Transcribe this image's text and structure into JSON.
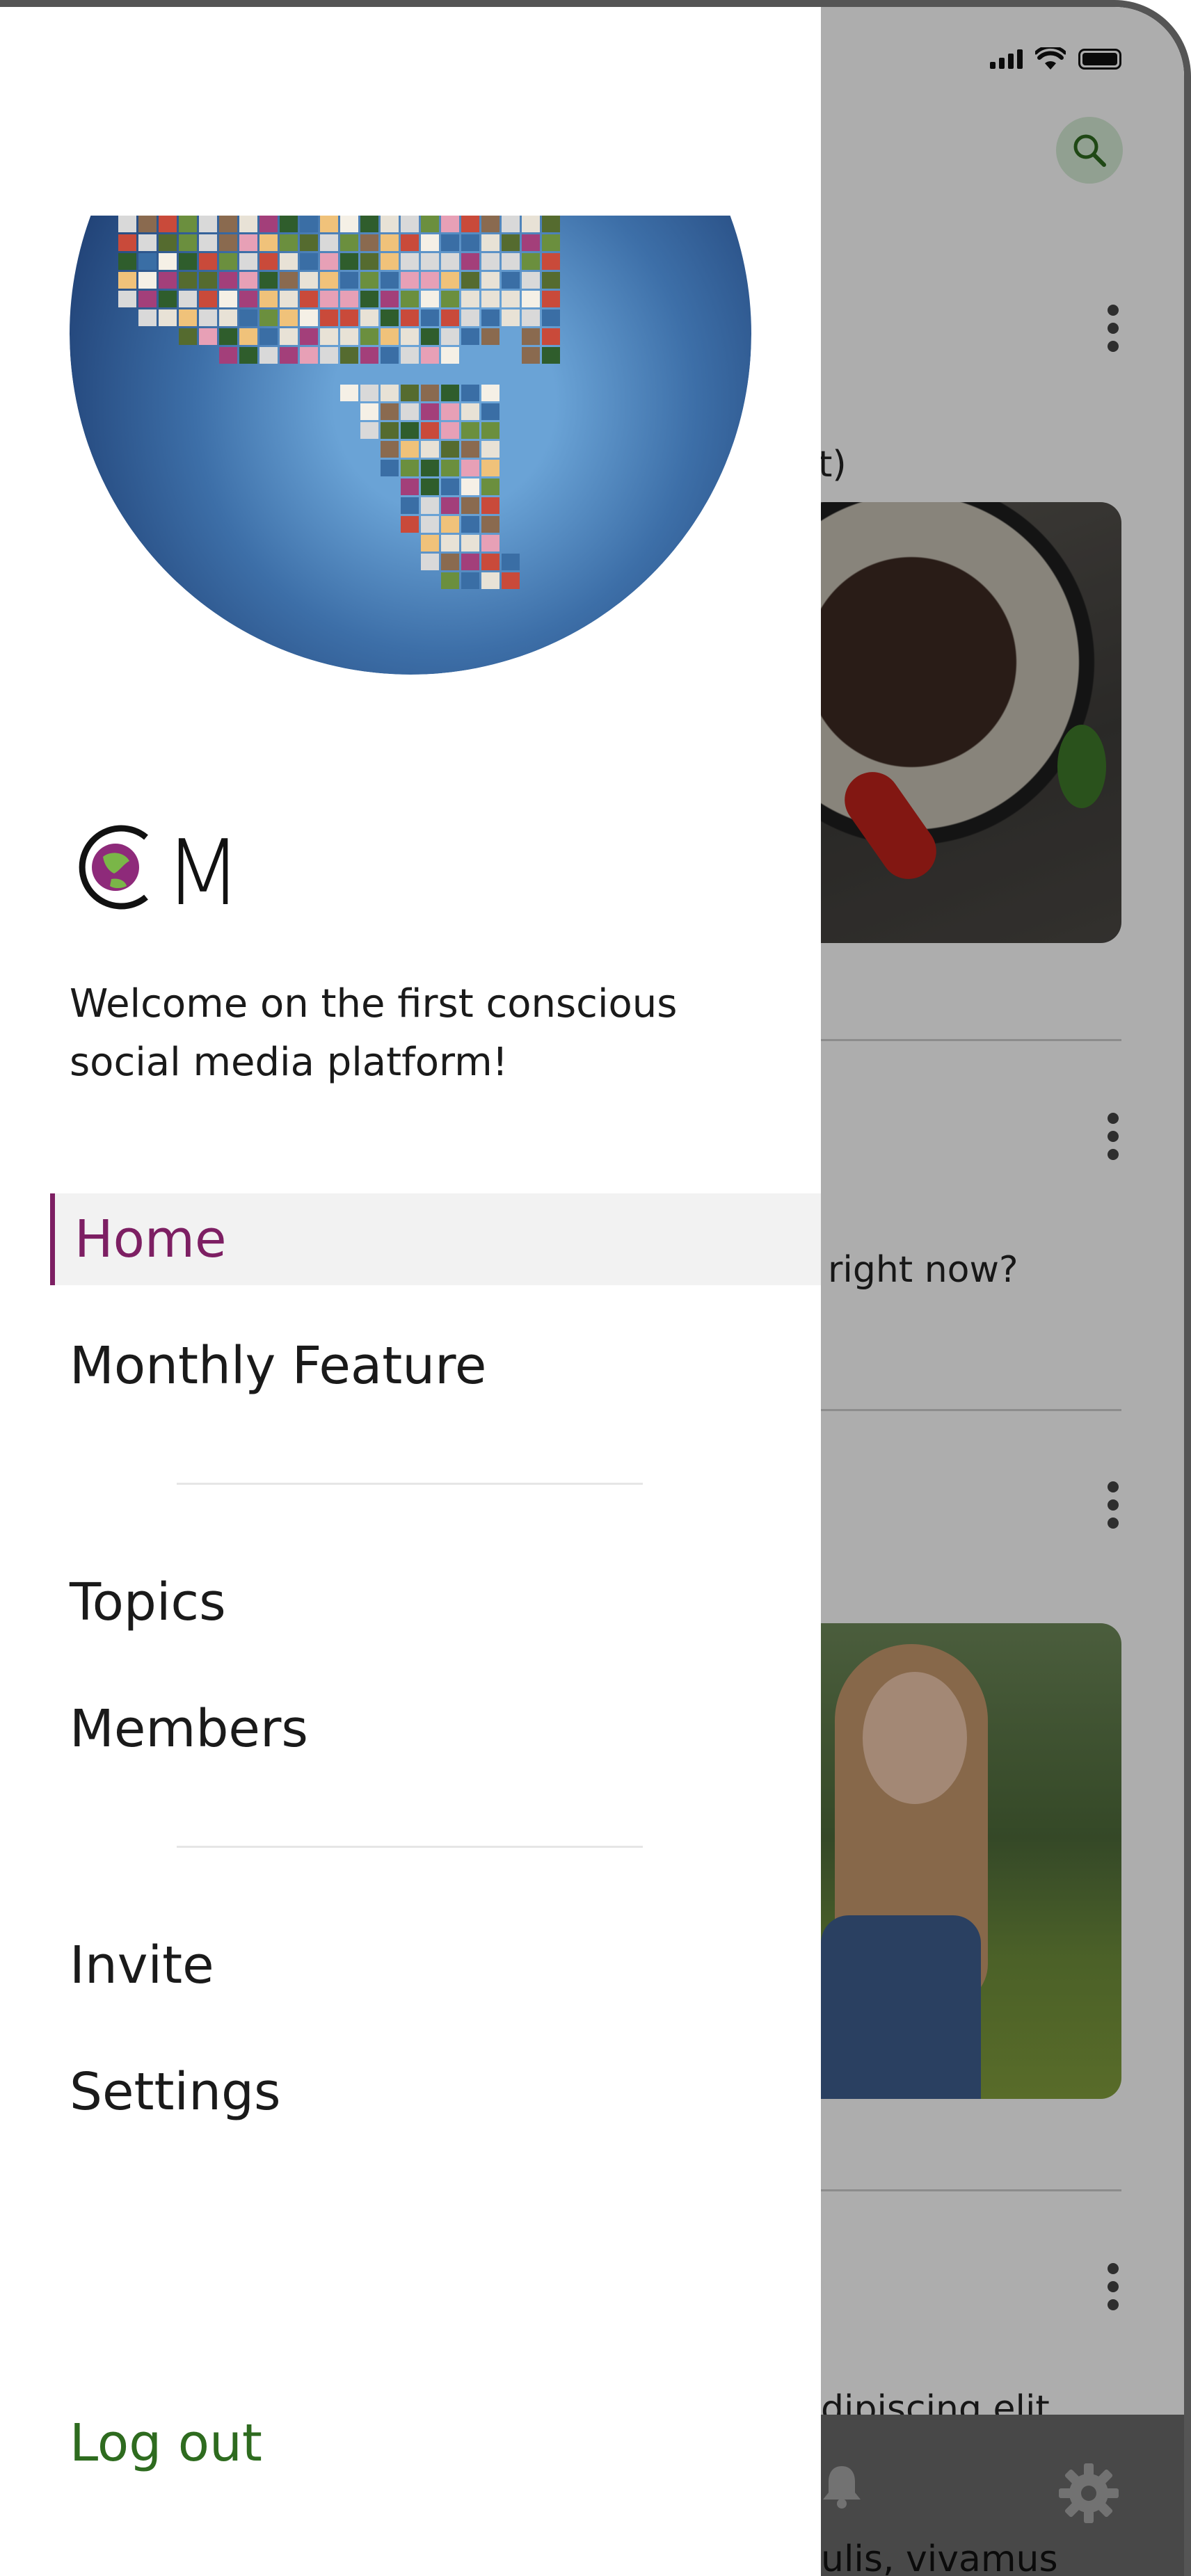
{
  "background_app": {
    "feed": [
      {
        "snippet": "t)"
      },
      {
        "snippet": "right now?"
      },
      {
        "snippet": "dipiscing elit"
      },
      {
        "snippet": "ulis, vivamus"
      }
    ],
    "icons": {
      "search": "search-icon",
      "more": "more-options-icon",
      "notifications": "bell-icon",
      "settings": "gear-icon"
    }
  },
  "drawer": {
    "welcome_text": "Welcome on the first conscious social media platform!",
    "nav_primary": [
      {
        "label": "Home",
        "active": true
      },
      {
        "label": "Monthly Feature",
        "active": false
      }
    ],
    "nav_secondary": [
      {
        "label": "Topics"
      },
      {
        "label": "Members"
      }
    ],
    "nav_tertiary": [
      {
        "label": "Invite"
      },
      {
        "label": "Settings"
      }
    ],
    "logout_label": "Log out"
  },
  "logo": {
    "text": "CM",
    "colors": {
      "ink": "#111111",
      "globe_land": "#7ab648",
      "globe_sea": "#8e2a7a"
    }
  },
  "colors": {
    "accent": "#7d1f63",
    "logout": "#2e6b1f",
    "active_bg": "#f2f2f2",
    "search_bg": "#d6ecd6"
  }
}
